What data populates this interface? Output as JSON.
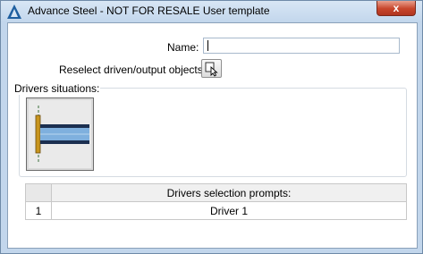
{
  "window": {
    "title": "Advance Steel - NOT FOR RESALE  User template",
    "close_glyph": "x"
  },
  "form": {
    "name_label": "Name:",
    "name_value": "",
    "reselect_label": "Reselect driven/output objects:",
    "reselect_icon": "select-cursor-icon"
  },
  "drivers": {
    "legend": "Drivers situations:",
    "thumbnail_icon": "beam-end-plate-icon"
  },
  "prompts": {
    "header": "Drivers selection prompts:",
    "rows": [
      {
        "num": "1",
        "label": "Driver 1"
      }
    ]
  },
  "colors": {
    "accent": "#1f5fa0",
    "close": "#c7452b"
  }
}
